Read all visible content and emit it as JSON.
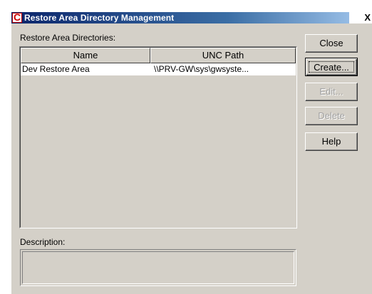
{
  "window": {
    "title": "Restore Area Directory Management",
    "close_glyph": "X"
  },
  "list": {
    "label": "Restore Area Directories:",
    "columns": [
      "Name",
      "UNC Path"
    ],
    "rows": [
      {
        "name": "Dev Restore Area",
        "unc_path": "\\\\PRV-GW\\sys\\gwsyste..."
      }
    ]
  },
  "description": {
    "label": "Description:",
    "value": ""
  },
  "buttons": {
    "close": "Close",
    "create": "Create...",
    "edit": "Edit...",
    "delete": "Delete",
    "help": "Help"
  },
  "colors": {
    "titlebar_start": "#0a246a",
    "titlebar_end": "#a6caf0",
    "face": "#d4d0c8",
    "disabled_text": "#a0a0a0"
  }
}
